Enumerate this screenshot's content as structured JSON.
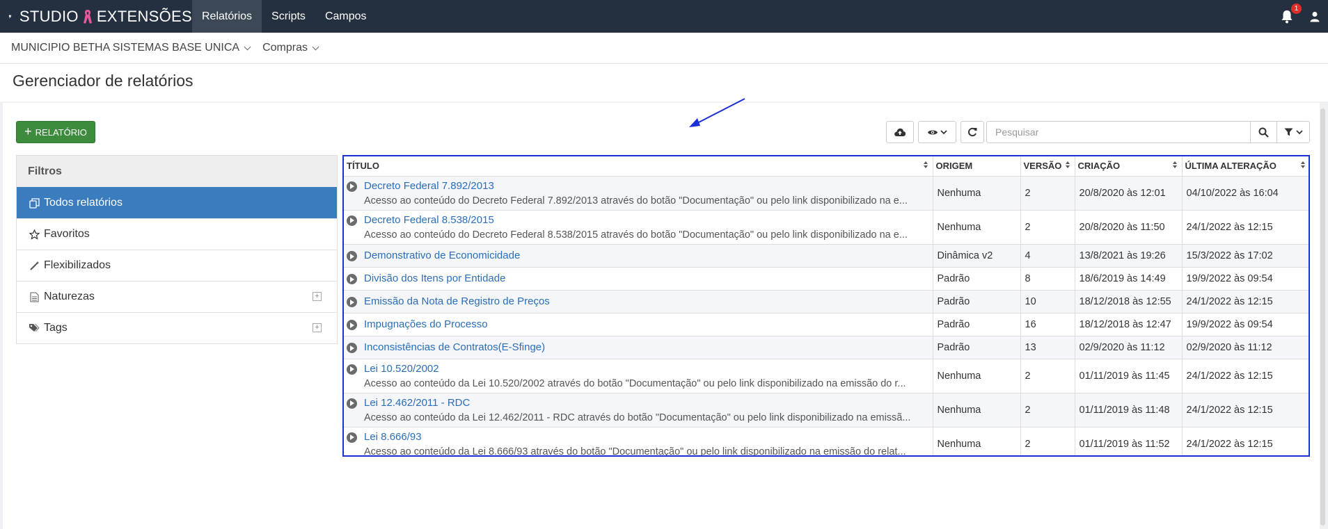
{
  "app": {
    "brand_left": "STUDIO",
    "brand_right": "EXTENSÕES",
    "nav": [
      "Relatórios",
      "Scripts",
      "Campos"
    ],
    "notification_count": "1"
  },
  "breadcrumb": [
    "MUNICIPIO BETHA SISTEMAS BASE UNICA",
    "Compras"
  ],
  "page_title": "Gerenciador de relatórios",
  "toolbar": {
    "add_label": "RELATÓRIO",
    "search_placeholder": "Pesquisar"
  },
  "filters": {
    "header": "Filtros",
    "items": [
      {
        "label": "Todos relatórios",
        "icon": "copy-icon"
      },
      {
        "label": "Favoritos",
        "icon": "star-icon"
      },
      {
        "label": "Flexibilizados",
        "icon": "magic-wand-icon"
      },
      {
        "label": "Naturezas",
        "icon": "file-icon"
      },
      {
        "label": "Tags",
        "icon": "tags-icon"
      }
    ]
  },
  "table": {
    "columns": [
      "TÍTULO",
      "ORIGEM",
      "VERSÃO",
      "CRIAÇÃO",
      "ÚLTIMA ALTERAÇÃO"
    ],
    "rows": [
      {
        "title": "Decreto Federal 7.892/2013",
        "desc": "Acesso ao conteúdo do Decreto Federal 7.892/2013 através do botão \"Documentação\" ou pelo link disponibilizado na e...",
        "origem": "Nenhuma",
        "versao": "2",
        "criacao": "20/8/2020 às 12:01",
        "alteracao": "04/10/2022 às 16:04"
      },
      {
        "title": "Decreto Federal 8.538/2015",
        "desc": "Acesso ao conteúdo do Decreto Federal 8.538/2015 através do botão \"Documentação\" ou pelo link disponibilizado na e...",
        "origem": "Nenhuma",
        "versao": "2",
        "criacao": "20/8/2020 às 11:50",
        "alteracao": "24/1/2022 às 12:15"
      },
      {
        "title": "Demonstrativo de Economicidade",
        "desc": "",
        "origem": "Dinâmica v2",
        "versao": "4",
        "criacao": "13/8/2021 às 19:26",
        "alteracao": "15/3/2022 às 17:02"
      },
      {
        "title": "Divisão dos Itens por Entidade",
        "desc": "",
        "origem": "Padrão",
        "versao": "8",
        "criacao": "18/6/2019 às 14:49",
        "alteracao": "19/9/2022 às 09:54"
      },
      {
        "title": "Emissão da Nota de Registro de Preços",
        "desc": "",
        "origem": "Padrão",
        "versao": "10",
        "criacao": "18/12/2018 às 12:55",
        "alteracao": "24/1/2022 às 12:15"
      },
      {
        "title": "Impugnações do Processo",
        "desc": "",
        "origem": "Padrão",
        "versao": "16",
        "criacao": "18/12/2018 às 12:47",
        "alteracao": "19/9/2022 às 09:54"
      },
      {
        "title": "Inconsistências de Contratos(E-Sfinge)",
        "desc": "",
        "origem": "Padrão",
        "versao": "13",
        "criacao": "02/9/2020 às 11:12",
        "alteracao": "02/9/2020 às 11:12"
      },
      {
        "title": "Lei 10.520/2002",
        "desc": "Acesso ao conteúdo da Lei 10.520/2002 através do botão \"Documentação\" ou pelo link disponibilizado na emissão do r...",
        "origem": "Nenhuma",
        "versao": "2",
        "criacao": "01/11/2019 às 11:45",
        "alteracao": "24/1/2022 às 12:15"
      },
      {
        "title": "Lei 12.462/2011 - RDC",
        "desc": "Acesso ao conteúdo da Lei 12.462/2011 - RDC através do botão \"Documentação\" ou pelo link disponibilizado na emissã...",
        "origem": "Nenhuma",
        "versao": "2",
        "criacao": "01/11/2019 às 11:48",
        "alteracao": "24/1/2022 às 12:15"
      },
      {
        "title": "Lei 8.666/93",
        "desc": "Acesso ao conteúdo da Lei 8.666/93 através do botão \"Documentação\" ou pelo link disponibilizado na emissão do relat...",
        "origem": "Nenhuma",
        "versao": "2",
        "criacao": "01/11/2019 às 11:52",
        "alteracao": "24/1/2022 às 12:15"
      }
    ]
  },
  "colors": {
    "topbar": "#24303f",
    "accent": "#3a7cbd",
    "add_button": "#3d8b3d",
    "highlight_border": "#1b2fd6"
  }
}
